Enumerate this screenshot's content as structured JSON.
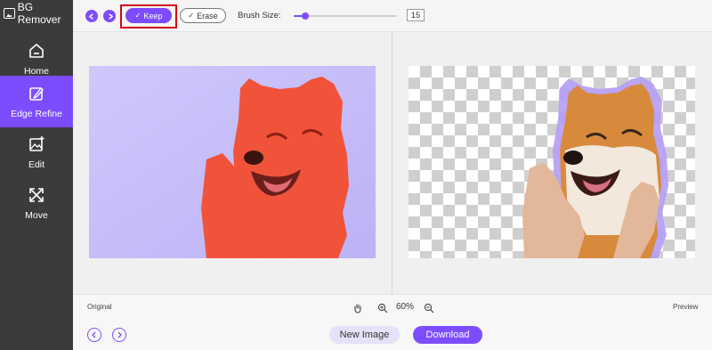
{
  "app": {
    "title": "BG Remover"
  },
  "sidebar": {
    "items": [
      {
        "label": "Home",
        "icon": "home-icon",
        "active": false
      },
      {
        "label": "Edge Refine",
        "icon": "edge-refine-icon",
        "active": true
      },
      {
        "label": "Edit",
        "icon": "edit-image-icon",
        "active": false
      },
      {
        "label": "Move",
        "icon": "move-icon",
        "active": false
      }
    ]
  },
  "toolbar": {
    "undo_icon": "undo-icon",
    "redo_icon": "redo-icon",
    "keep_label": "Keep",
    "erase_label": "Erase",
    "brush_label": "Brush Size:",
    "brush_value": "15",
    "brush_level": 0.11
  },
  "canvas": {
    "original_label": "Original",
    "preview_label": "Preview",
    "zoom": "60%"
  },
  "footer": {
    "new_image_label": "New Image",
    "download_label": "Download"
  },
  "colors": {
    "accent": "#7c4dff",
    "sidebar_bg": "#3b3b3b",
    "highlight": "#d0021b",
    "keep_overlay": "#ff5733"
  }
}
